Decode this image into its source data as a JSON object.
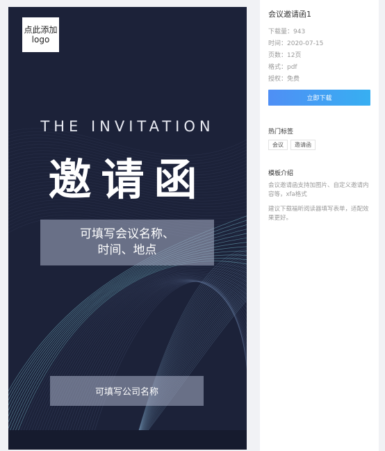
{
  "preview": {
    "logo_line1": "点此添加",
    "logo_line2": "logo",
    "heading_en": "THE INVITATION",
    "heading_cn": "邀请函",
    "meeting_line1": "可填写会议名称、",
    "meeting_line2": "时间、地点",
    "company_text": "可填写公司名称"
  },
  "details": {
    "title": "会议邀请函1",
    "downloads": "下载量：943",
    "time": "时间：2020-07-15",
    "pages": "页数：12页",
    "format": "格式：pdf",
    "license": "授权：免费",
    "download_button": "立即下载",
    "hot_tags_title": "热门标签",
    "tags": [
      "会议",
      "邀请函"
    ],
    "intro_title": "模板介绍",
    "intro_text": "会议邀请函支持加图片、自定义邀请内容等，xfa格式",
    "intro_tip": "建议下载福昕阅读器填写表单，适配效果更好。"
  },
  "colors": {
    "canvas_bg": "#1c2239",
    "accent_start": "#4f8ff5",
    "accent_end": "#37aff2"
  }
}
